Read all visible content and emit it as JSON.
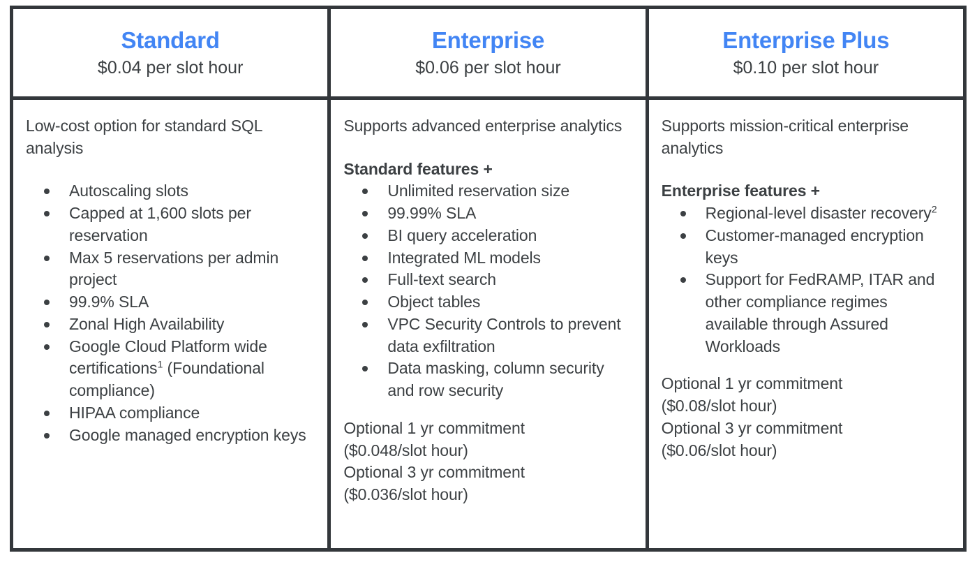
{
  "theme": {
    "accent_blue": "#4285F4",
    "border_color": "#33373B",
    "text_color": "#3C4043",
    "background": "#FFFFFF"
  },
  "columns": [
    {
      "tier": "Standard",
      "price": "$0.04 per slot hour",
      "intro": "Low-cost option for standard SQL analysis",
      "section_heading": null,
      "features": [
        "Autoscaling slots",
        "Capped at 1,600 slots per reservation",
        "Max 5 reservations per admin project",
        "99.9% SLA",
        "Zonal High Availability",
        "Google Cloud Platform wide certifications¹ (Foundational compliance)",
        "HIPAA compliance",
        "Google managed encryption keys"
      ],
      "commitments": []
    },
    {
      "tier": "Enterprise",
      "price": "$0.06 per slot hour",
      "intro": "Supports advanced enterprise analytics",
      "section_heading": "Standard features +",
      "features": [
        "Unlimited reservation size",
        "99.99% SLA",
        "BI query acceleration",
        "Integrated ML models",
        "Full-text search",
        "Object tables",
        "VPC Security Controls to prevent data exfiltration",
        "Data masking, column security and row security"
      ],
      "commitments": [
        {
          "term": "Optional 1 yr commitment",
          "rate": "($0.048/slot hour)"
        },
        {
          "term": "Optional 3 yr commitment",
          "rate": "($0.036/slot hour)"
        }
      ]
    },
    {
      "tier": "Enterprise Plus",
      "price": "$0.10 per slot hour",
      "intro": "Supports mission-critical enterprise analytics",
      "section_heading": "Enterprise features +",
      "features": [
        "Regional-level disaster recovery²",
        "Customer-managed encryption keys",
        "Support for FedRAMP, ITAR and other compliance regimes available through Assured Workloads"
      ],
      "commitments": [
        {
          "term": "Optional 1 yr commitment",
          "rate": "($0.08/slot hour)"
        },
        {
          "term": "Optional 3 yr commitment",
          "rate": "($0.06/slot hour)"
        }
      ]
    }
  ]
}
